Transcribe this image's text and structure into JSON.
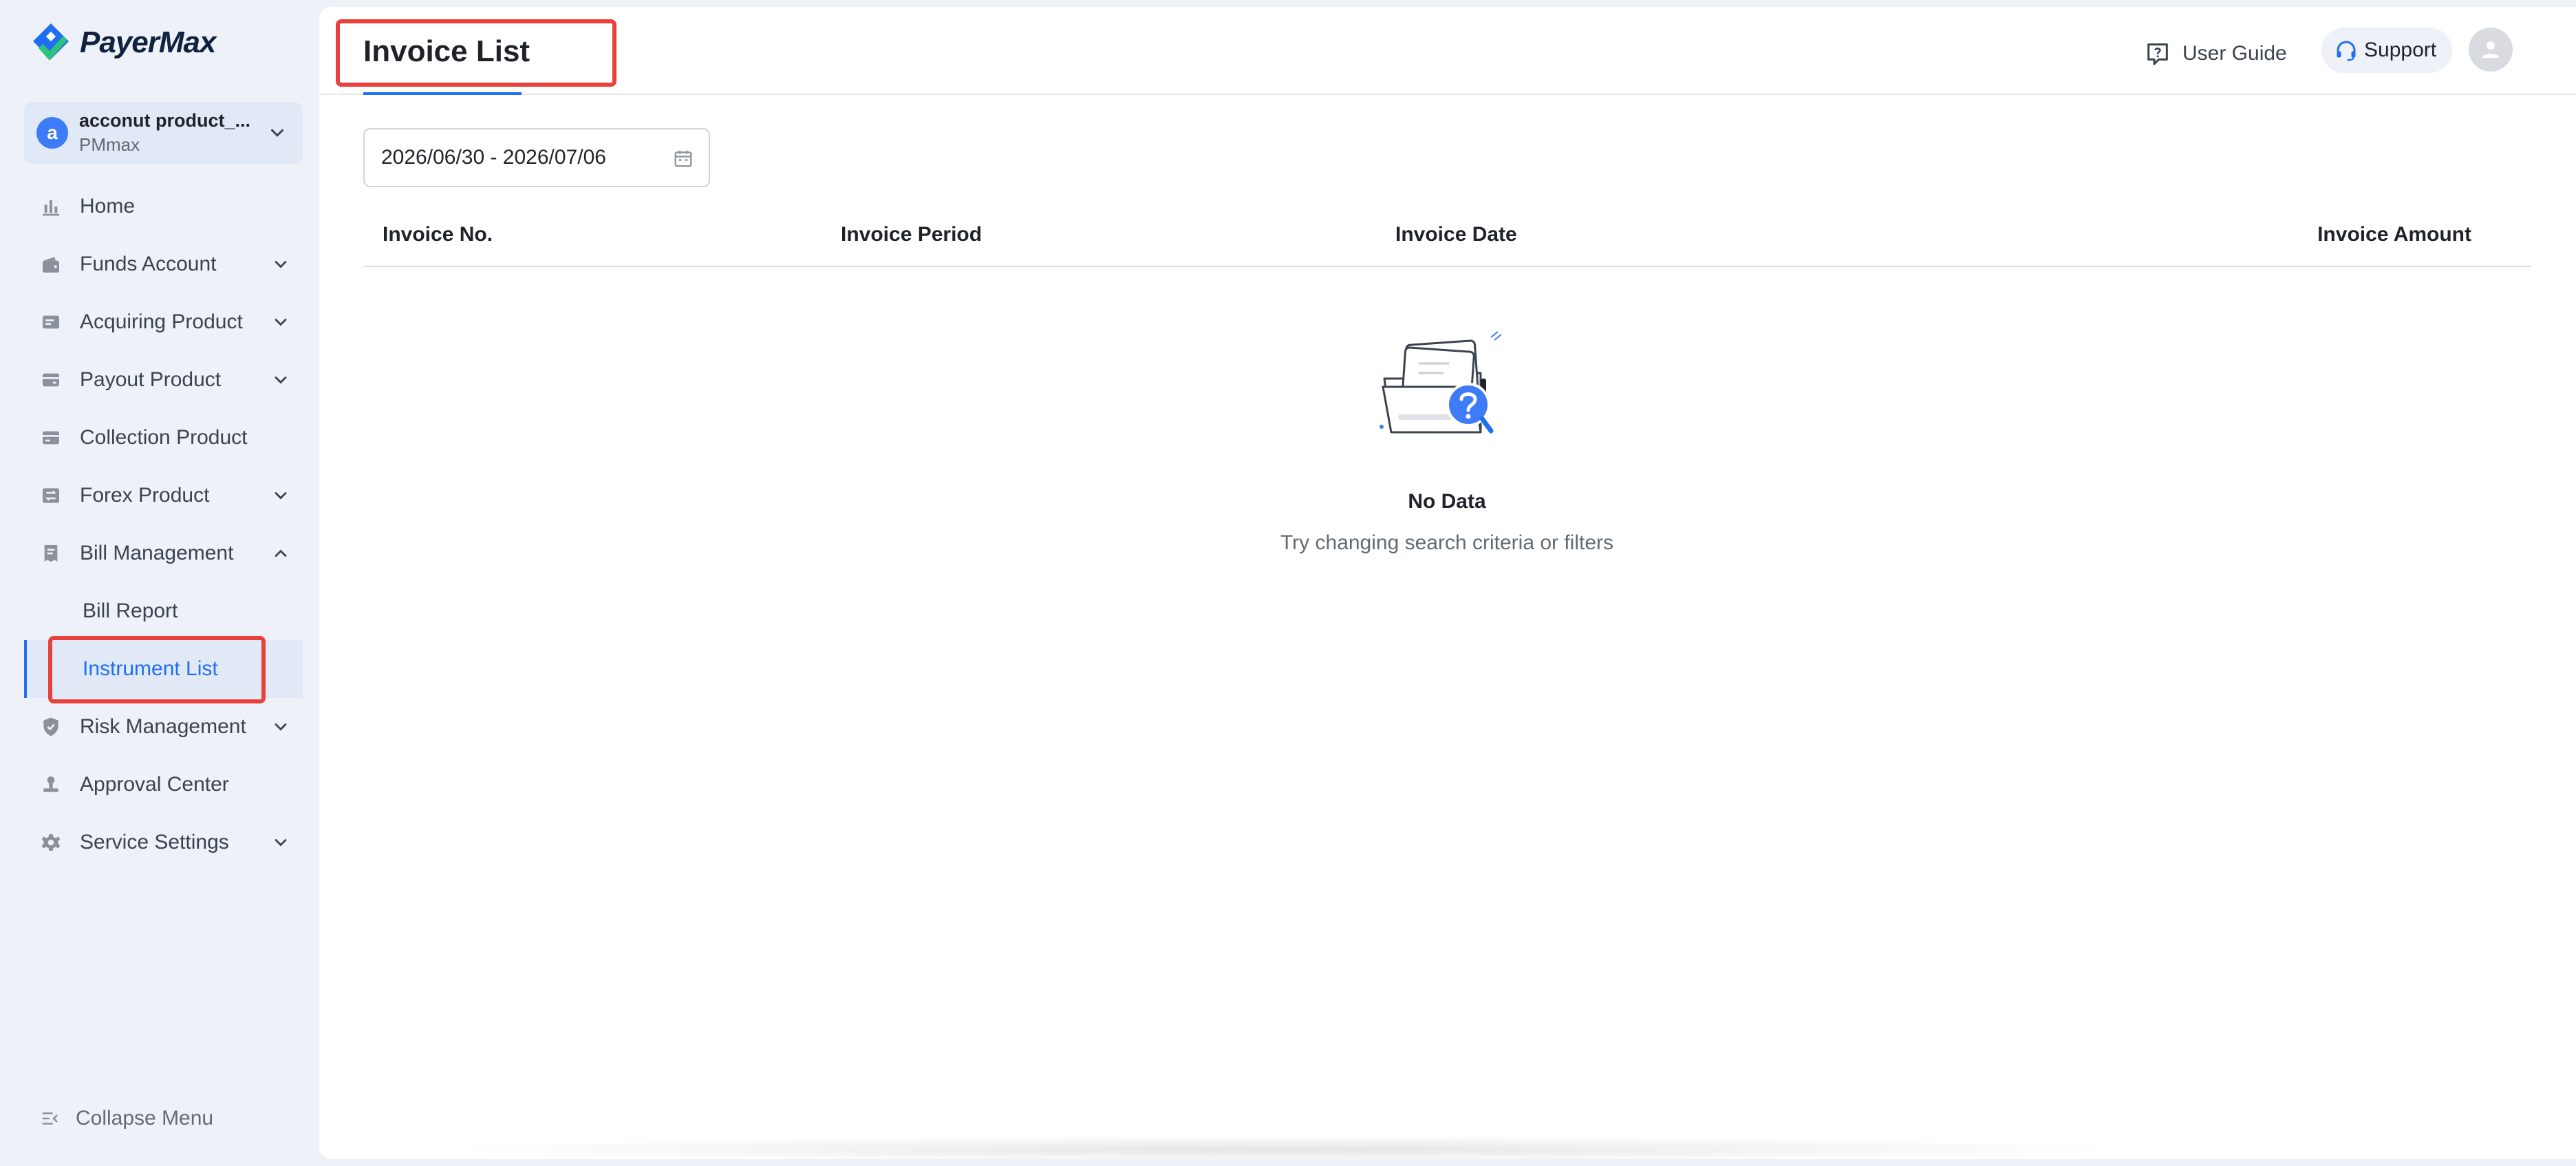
{
  "brand": {
    "name": "PayerMax"
  },
  "account": {
    "initial": "a",
    "name": "acconut product_...",
    "sub": "PMmax"
  },
  "nav": {
    "home": "Home",
    "funds": "Funds Account",
    "acquiring": "Acquiring Product",
    "payout": "Payout Product",
    "collection": "Collection Product",
    "forex": "Forex Product",
    "bill": "Bill Management",
    "bill_report": "Bill Report",
    "instrument_list": "Instrument List",
    "risk": "Risk Management",
    "approval": "Approval Center",
    "service": "Service Settings",
    "collapse": "Collapse Menu"
  },
  "header": {
    "title": "Invoice List",
    "user_guide": "User Guide",
    "support": "Support"
  },
  "filter": {
    "date_range": "2026/06/30 - 2026/07/06"
  },
  "table": {
    "columns": [
      "Invoice No.",
      "Invoice Period",
      "Invoice Date",
      "Invoice Amount"
    ],
    "rows": []
  },
  "empty": {
    "title": "No Data",
    "subtitle": "Try changing search criteria or filters"
  },
  "colors": {
    "accent": "#1f6ff2",
    "highlight": "#e8413c",
    "sidebar_bg": "#eef1f7"
  }
}
